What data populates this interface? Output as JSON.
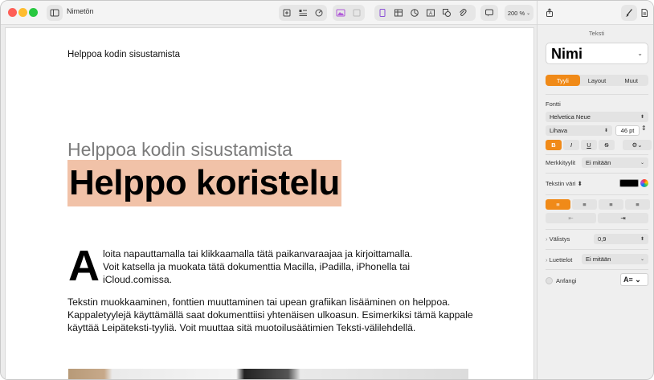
{
  "window": {
    "title": "Nimetön"
  },
  "toolbar": {
    "zoom": "200 %"
  },
  "document": {
    "header": "Helppoa kodin sisustamista",
    "subtitle": "Helppoa kodin sisustamista",
    "title": "Helppo koristelu",
    "dropcap": "A",
    "paragraph1_line1": "loita napauttamalla tai klikkaamalla tätä paikanvaraajaa ja kirjoittamalla.",
    "paragraph1_line2": "Voit katsella ja muokata tätä dokumenttia Macilla, iPadilla, iPhonella tai",
    "paragraph1_line3": "iCloud.comissa.",
    "paragraph2": "Tekstin muokkaaminen, fonttien muuttaminen tai upean grafiikan lisääminen on helppoa. Kappaletyylejä käyttämällä saat dokumenttiisi yhtenäisen ulkoasun. Esimerkiksi tämä kappale käyttää Leipäteksti-tyyliä. Voit muuttaa sitä muotoilusäätimien Teksti-välilehdellä."
  },
  "sidebar": {
    "tab_label": "Teksti",
    "paragraph_style": "Nimi",
    "segments": [
      "Tyyli",
      "Layout",
      "Muut"
    ],
    "font_label": "Fontti",
    "font_family": "Helvetica Neue",
    "font_weight": "Lihava",
    "font_size": "46 pt",
    "format_buttons": [
      "B",
      "I",
      "U",
      "S"
    ],
    "char_styles_label": "Merkkityylit",
    "char_styles_value": "Ei mitään",
    "text_color_label": "Tekstin väri",
    "spacing_label": "Välistys",
    "spacing_value": "0,9",
    "lists_label": "Luettelot",
    "lists_value": "Ei mitään",
    "dropcap_label": "Anfangi",
    "accent_color": "#f08a18"
  }
}
